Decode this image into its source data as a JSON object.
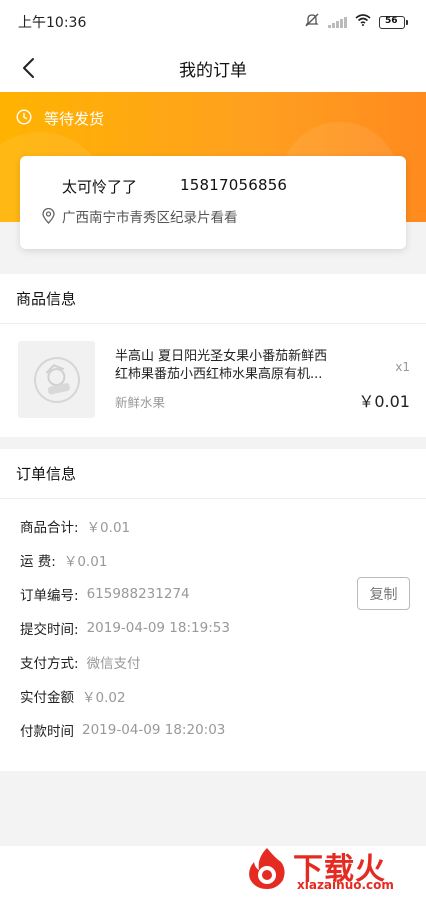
{
  "status_bar": {
    "time": "上午10:36",
    "battery": "56"
  },
  "nav": {
    "title": "我的订单"
  },
  "order_status": {
    "text": "等待发货"
  },
  "address": {
    "name": "太可怜了了",
    "phone": "15817056856",
    "address": "广西南宁市青秀区纪录片看看"
  },
  "goods": {
    "header": "商品信息",
    "item": {
      "title": "半高山 夏日阳光圣女果小番茄新鲜西红柿果番茄小西红柿水果高原有机...",
      "store": "新鲜水果",
      "quantity": "x1",
      "price": "￥0.01"
    }
  },
  "order_info": {
    "header": "订单信息",
    "rows": [
      {
        "label": "商品合计:",
        "value": "￥0.01"
      },
      {
        "label": "运 费:",
        "value": "￥0.01"
      },
      {
        "label": "订单编号:",
        "value": "615988231274"
      },
      {
        "label": "提交时间:",
        "value": "2019-04-09 18:19:53"
      },
      {
        "label": "支付方式:",
        "value": "微信支付"
      },
      {
        "label": "实付金额",
        "value": "￥0.02"
      },
      {
        "label": "付款时间",
        "value": "2019-04-09 18:20:03"
      }
    ],
    "copy_label": "复制"
  },
  "watermark": {
    "brand": "下载火",
    "url": "xiazaihuo.com"
  },
  "colors": {
    "accent": "#ffa61e",
    "watermark": "#e52a22"
  }
}
